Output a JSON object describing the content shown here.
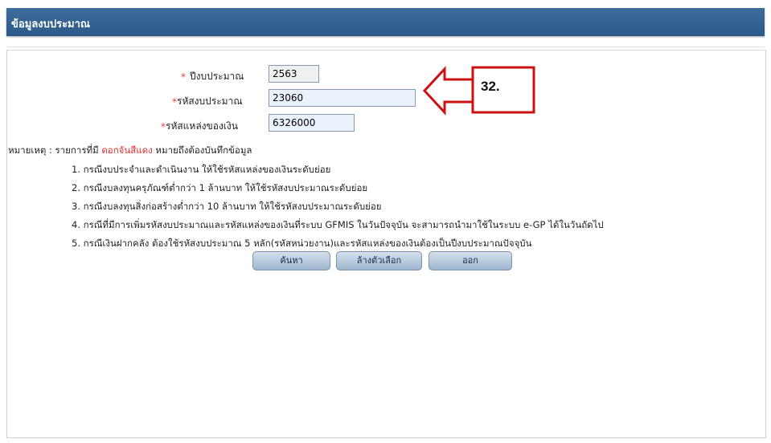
{
  "header": {
    "title": "ข้อมูลงบประมาณ"
  },
  "form": {
    "fiscal_year": {
      "required_mark": "*",
      "label": "ปีงบประมาณ",
      "value": "2563"
    },
    "budget_code": {
      "required_mark": "*",
      "label": "รหัสงบประมาณ",
      "value": "23060"
    },
    "fund_source": {
      "required_mark": "*",
      "label": "รหัสแหล่งของเงิน",
      "value": "6326000"
    }
  },
  "annotation": {
    "label": "32."
  },
  "notes": {
    "prefix": "หมายเหตุ : รายการที่มี ",
    "highlight": "ดอกจันสีแดง",
    "suffix": " หมายถึงต้องบันทึกข้อมูล",
    "items": [
      "1. กรณีงบประจำและดำเนินงาน ให้ใช้รหัสแหล่งของเงินระดับย่อย",
      "2. กรณีงบลงทุนครุภัณฑ์ต่ำกว่า 1 ล้านบาท ให้ใช้รหัสงบประมาณระดับย่อย",
      "3. กรณีงบลงทุนสิ่งก่อสร้างต่ำกว่า 10 ล้านบาท ให้ใช้รหัสงบประมาณระดับย่อย",
      "4. กรณีที่มีการเพิ่มรหัสงบประมาณและรหัสแหล่งของเงินที่ระบบ GFMIS ในวันปัจจุบัน จะสามารถนำมาใช้ในระบบ e-GP ได้ในวันถัดไป",
      "5. กรณีเงินฝากคลัง ต้องใช้รหัสงบประมาณ 5 หลัก(รหัสหน่วยงาน)และรหัสแหล่งของเงินต้องเป็นปีงบประมาณปัจจุบัน"
    ]
  },
  "buttons": {
    "search": "ค้นหา",
    "clear": "ล้างตัวเลือก",
    "exit": "ออก"
  },
  "colors": {
    "header_bg": "#2f5d8c",
    "required": "#e03030",
    "callout": "#cc1111"
  }
}
